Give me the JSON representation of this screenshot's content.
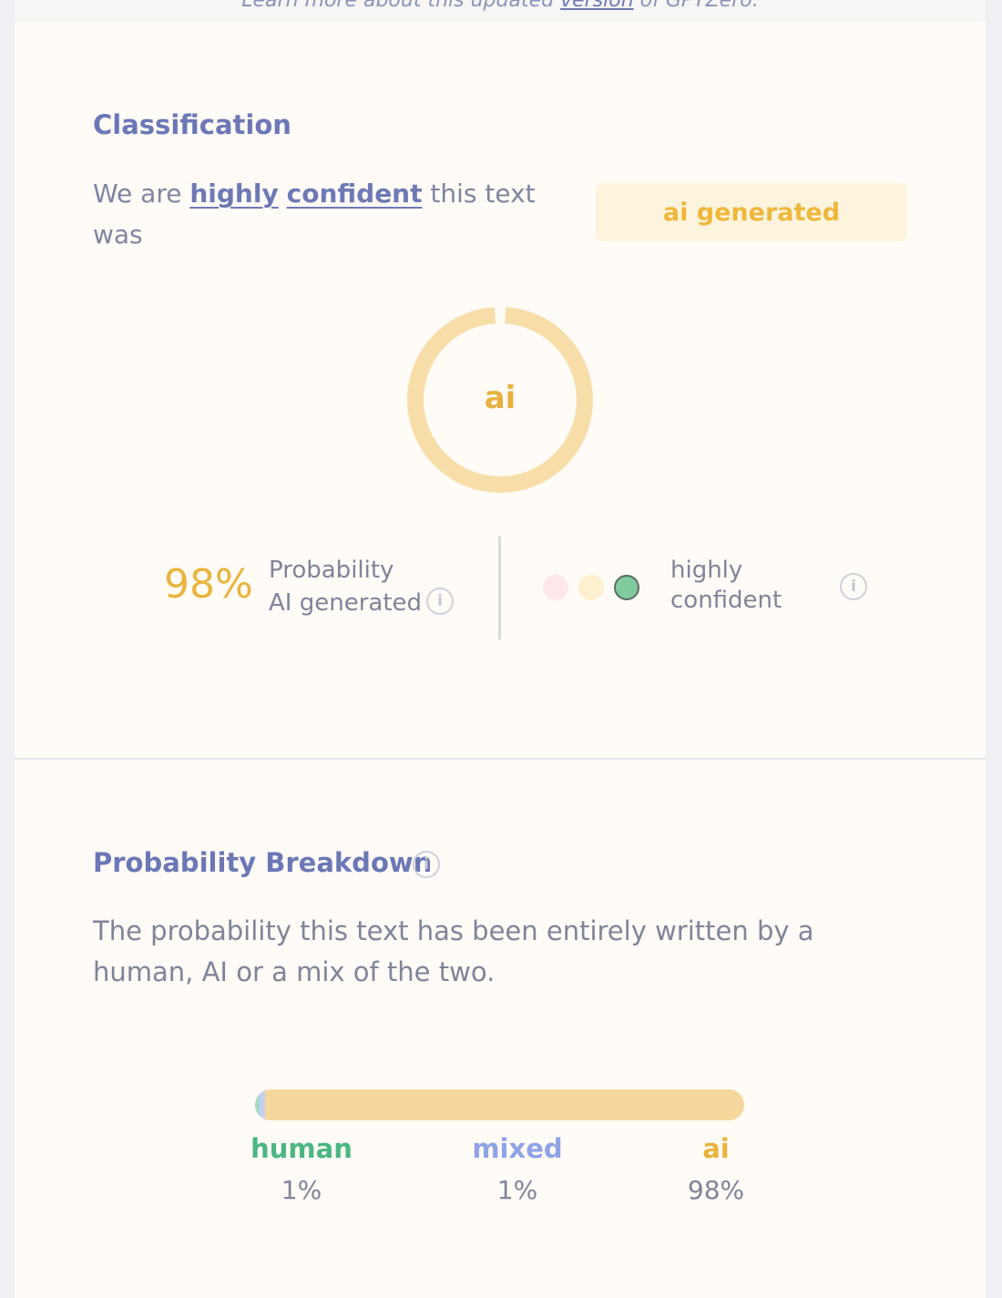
{
  "top_strip": {
    "text_before": "Learn more about this updated",
    "link": "version",
    "text_after": "of GPTZero."
  },
  "classification": {
    "title": "Classification",
    "lead_prefix": "We are",
    "lead_em1": "highly",
    "lead_em2": "confident",
    "lead_suffix": "this text was",
    "result_badge": "ai generated",
    "donut_label": "ai",
    "donut_ai_fraction": 0.98,
    "probability_value": "98%",
    "probability_line1": "Probability",
    "probability_line2": "AI generated",
    "confidence_line1": "highly",
    "confidence_line2": "confident",
    "confidence_dots": [
      "#fde7ea",
      "#fdf1cd",
      "#7fcb9e"
    ],
    "info_icon": "info-icon"
  },
  "breakdown": {
    "title": "Probability Breakdown",
    "subtitle": "The probability this text has been entirely written by a human, AI or a mix of the two.",
    "items": [
      {
        "label": "human",
        "value": "1%",
        "fraction": 0.01,
        "color": "#4bb683",
        "bar_color": "#a6d8c6"
      },
      {
        "label": "mixed",
        "value": "1%",
        "fraction": 0.01,
        "color": "#8ea2e6",
        "bar_color": "#c6cff0"
      },
      {
        "label": "ai",
        "value": "98%",
        "fraction": 0.98,
        "color": "#ebb33c",
        "bar_color": "#f6d89e"
      }
    ]
  }
}
